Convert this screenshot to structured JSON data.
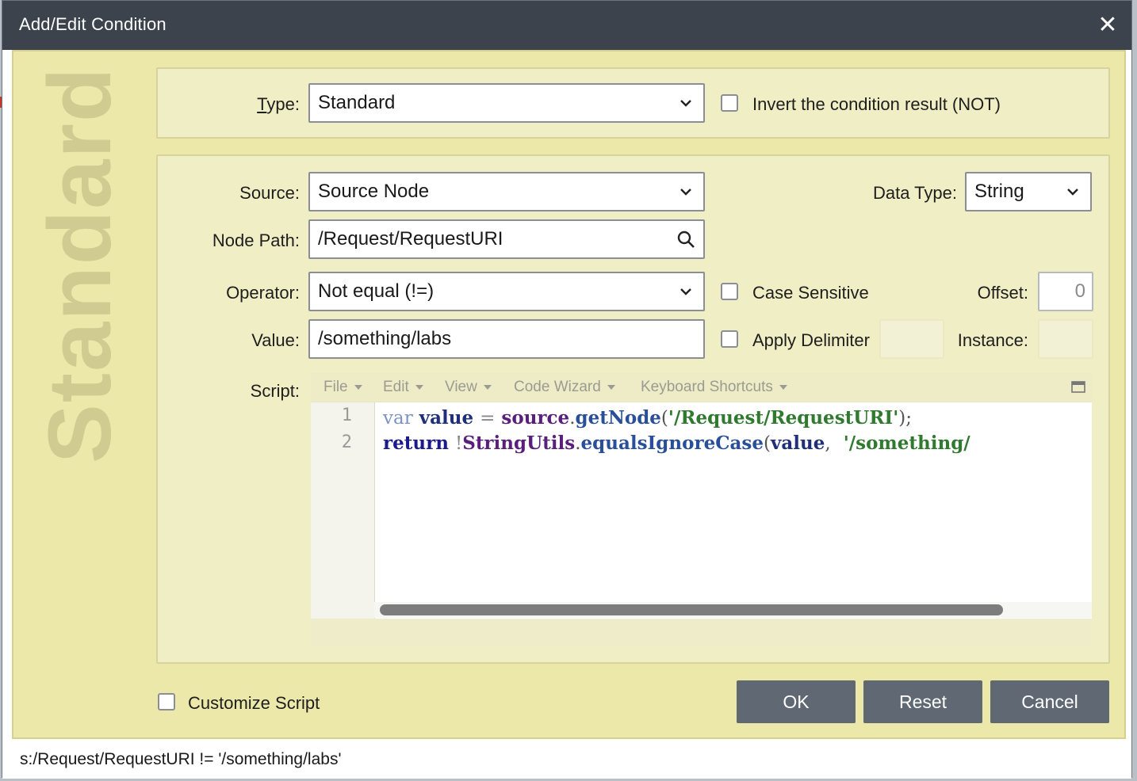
{
  "dialog": {
    "title": "Add/Edit Condition",
    "close_glyph": "✕"
  },
  "watermark": "Standard",
  "type_row": {
    "label": "Type:",
    "value": "Standard",
    "invert_label": "Invert the condition result (NOT)",
    "invert_checked": false
  },
  "form": {
    "source_label": "Source:",
    "source_value": "Source Node",
    "datatype_label": "Data Type:",
    "datatype_value": "String",
    "nodepath_label": "Node Path:",
    "nodepath_value": "/Request/RequestURI",
    "operator_label": "Operator:",
    "operator_value": "Not equal (!=)",
    "case_label": "Case Sensitive",
    "case_checked": false,
    "offset_label": "Offset:",
    "offset_value": "0",
    "value_label": "Value:",
    "value_value": "/something/labs",
    "delimiter_label": "Apply Delimiter",
    "delimiter_checked": false,
    "instance_label": "Instance:",
    "script_label": "Script:"
  },
  "script_editor": {
    "menus": [
      "File",
      "Edit",
      "View",
      "Code Wizard",
      "Keyboard Shortcuts"
    ],
    "line_numbers": [
      "1",
      "2"
    ]
  },
  "footer": {
    "customize_label": "Customize Script",
    "customize_checked": false,
    "ok": "OK",
    "reset": "Reset",
    "cancel": "Cancel"
  },
  "status_text": "s:/Request/RequestURI != '/something/labs'",
  "colors": {
    "titlebar": "#3c434c",
    "body": "#ebe8a9",
    "panel": "#f0eec4",
    "button": "#5f6873"
  }
}
